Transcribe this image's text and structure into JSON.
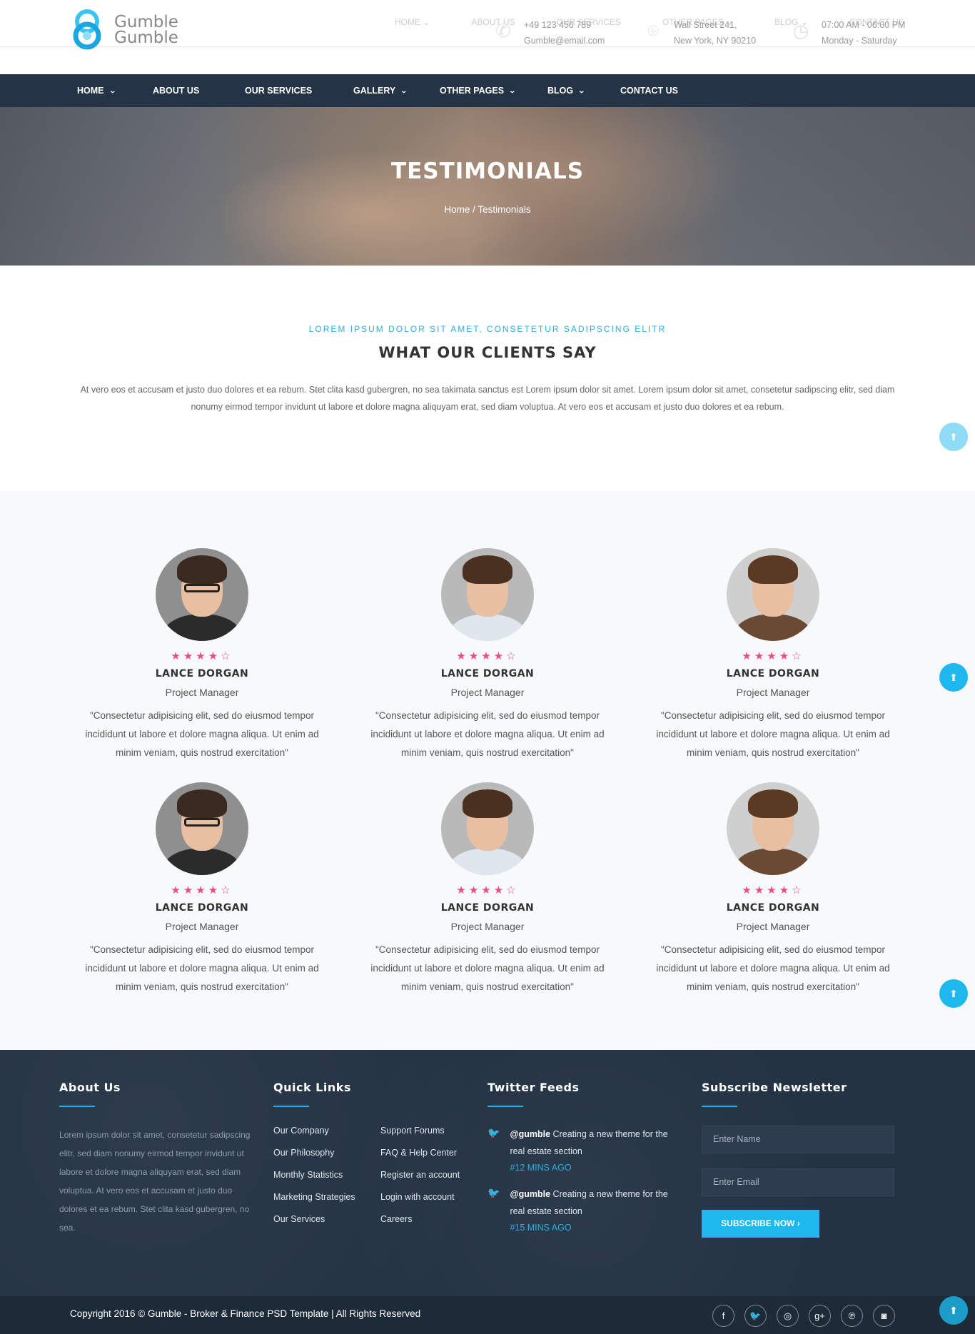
{
  "header": {
    "logo_line1": "Gumble",
    "logo_line2": "Gumble",
    "ghost_nav": [
      "HOME ⌄",
      "ABOUT US",
      "OUR SERVICES",
      "OTHER PAGES ⌄",
      "BLOG ⌄",
      "CONTACT US"
    ],
    "contacts": [
      {
        "icon": "phone-icon",
        "line1": "+49 123 456 789",
        "line2": "Gumble@email.com"
      },
      {
        "icon": "map-pin-icon",
        "line1": "Wall Street 241,",
        "line2": "New York, NY 90210"
      },
      {
        "icon": "clock-icon",
        "line1": "07:00 AM - 06:00 PM",
        "line2": "Monday - Saturday"
      }
    ]
  },
  "nav": {
    "items": [
      {
        "label": "HOME",
        "dropdown": true
      },
      {
        "label": "ABOUT US",
        "dropdown": false
      },
      {
        "label": "OUR SERVICES",
        "dropdown": false
      },
      {
        "label": "GALLERY",
        "dropdown": true
      },
      {
        "label": "OTHER PAGES",
        "dropdown": true
      },
      {
        "label": "BLOG",
        "dropdown": true
      },
      {
        "label": "CONTACT US",
        "dropdown": false
      }
    ]
  },
  "hero": {
    "title": "TESTIMONIALS",
    "breadcrumb": "Home / Testimonials"
  },
  "intro": {
    "kicker": "LOREM IPSUM DOLOR SIT AMET, CONSETETUR SADIPSCING ELITR",
    "title": "WHAT OUR CLIENTS SAY",
    "text": "At vero eos et accusam et justo duo dolores et ea rebum. Stet clita kasd gubergren, no sea takimata sanctus est Lorem ipsum dolor sit amet. Lorem ipsum dolor sit amet, consetetur sadipscing elitr, sed diam nonumy eirmod tempor invidunt ut labore et dolore magna aliquyam erat, sed diam voluptua. At vero eos et accusam et justo duo dolores et ea rebum."
  },
  "testimonials": [
    {
      "name": "LANCE DORGAN",
      "role": "Project Manager",
      "rating": 4,
      "max_rating": 5,
      "avatar": "man-glasses",
      "quote": "\"Consectetur adipisicing elit, sed do eiusmod tempor incididunt ut labore et dolore magna aliqua. Ut enim ad minim veniam, quis nostrud exercitation\""
    },
    {
      "name": "LANCE DORGAN",
      "role": "Project Manager",
      "rating": 4,
      "max_rating": 5,
      "avatar": "man-smiling",
      "quote": "\"Consectetur adipisicing elit, sed do eiusmod tempor incididunt ut labore et dolore magna aliqua. Ut enim ad minim veniam, quis nostrud exercitation\""
    },
    {
      "name": "LANCE DORGAN",
      "role": "Project Manager",
      "rating": 4,
      "max_rating": 5,
      "avatar": "woman-smiling",
      "quote": "\"Consectetur adipisicing elit, sed do eiusmod tempor incididunt ut labore et dolore magna aliqua. Ut enim ad minim veniam, quis nostrud exercitation\""
    },
    {
      "name": "LANCE DORGAN",
      "role": "Project Manager",
      "rating": 4,
      "max_rating": 5,
      "avatar": "man-glasses",
      "quote": "\"Consectetur adipisicing elit, sed do eiusmod tempor incididunt ut labore et dolore magna aliqua. Ut enim ad minim veniam, quis nostrud exercitation\""
    },
    {
      "name": "LANCE DORGAN",
      "role": "Project Manager",
      "rating": 4,
      "max_rating": 5,
      "avatar": "man-smiling",
      "quote": "\"Consectetur adipisicing elit, sed do eiusmod tempor incididunt ut labore et dolore magna aliqua. Ut enim ad minim veniam, quis nostrud exercitation\""
    },
    {
      "name": "LANCE DORGAN",
      "role": "Project Manager",
      "rating": 4,
      "max_rating": 5,
      "avatar": "woman-smiling",
      "quote": "\"Consectetur adipisicing elit, sed do eiusmod tempor incididunt ut labore et dolore magna aliqua. Ut enim ad minim veniam, quis nostrud exercitation\""
    }
  ],
  "footer": {
    "about": {
      "heading": "About Us",
      "text": "Lorem ipsum dolor sit amet, consetetur sadipscing elitr, sed diam nonumy eirmod tempor invidunt ut labore et dolore magna aliquyam erat, sed diam voluptua. At vero eos et accusam et justo duo dolores et ea rebum. Stet clita kasd gubergren, no sea."
    },
    "quick_links": {
      "heading": "Quick Links",
      "links": [
        "Our Company",
        "Support Forums",
        "Our Philosophy",
        "FAQ & Help Center",
        "Monthly Statistics",
        "Register an account",
        "Marketing Strategies",
        "Login with account",
        "Our Services",
        "Careers"
      ]
    },
    "twitter": {
      "heading": "Twitter Feeds",
      "tweets": [
        {
          "handle": "@gumble",
          "text": " Creating a new theme for the real estate section",
          "time": "#12 MINS AGO"
        },
        {
          "handle": "@gumble",
          "text": " Creating a new theme for the real estate section",
          "time": "#15 MINS AGO"
        }
      ]
    },
    "newsletter": {
      "heading": "Subscribe Newsletter",
      "name_placeholder": "Enter Name",
      "email_placeholder": "Enter Email",
      "button": "SUBSCRIBE NOW  ›"
    },
    "copyright": "Copyright 2016 © Gumble - Broker & Finance PSD Template | All Rights Reserved",
    "socials": [
      {
        "icon": "facebook-icon",
        "glyph": "f"
      },
      {
        "icon": "twitter-icon",
        "glyph": "🐦"
      },
      {
        "icon": "dribbble-icon",
        "glyph": "◎"
      },
      {
        "icon": "google-plus-icon",
        "glyph": "g+"
      },
      {
        "icon": "pinterest-icon",
        "glyph": "℗"
      },
      {
        "icon": "instagram-icon",
        "glyph": "◙"
      }
    ]
  },
  "colors": {
    "accent": "#29aee3",
    "nav_bg": "#243446",
    "footer_bg": "#243344",
    "star": "#e94d87"
  }
}
